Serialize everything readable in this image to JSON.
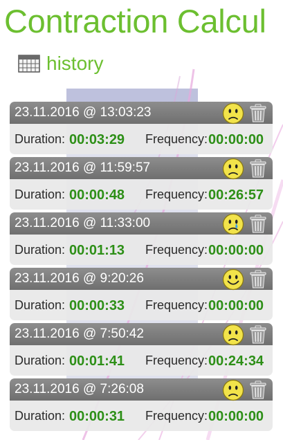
{
  "app": {
    "title": "Contraction Calcul"
  },
  "section": {
    "title": "history",
    "icon": "calendar-icon"
  },
  "labels": {
    "duration": "Duration:",
    "frequency": "Frequency:"
  },
  "icons": {
    "mood": "smiley-face-icon",
    "delete": "trash-icon"
  },
  "colors": {
    "accent": "#6cbf30",
    "value": "#2d8f17",
    "header": "#7a7a7a",
    "smiley": "#f2e34a"
  },
  "entries": [
    {
      "timestamp": "23.11.2016 @ 13:03:23",
      "duration": "00:03:29",
      "frequency": "00:00:00",
      "mood": "sad"
    },
    {
      "timestamp": "23.11.2016 @ 11:59:57",
      "duration": "00:00:48",
      "frequency": "00:26:57",
      "mood": "sad"
    },
    {
      "timestamp": "23.11.2016 @ 11:33:00",
      "duration": "00:01:13",
      "frequency": "00:00:00",
      "mood": "crying"
    },
    {
      "timestamp": "23.11.2016 @ 9:20:26",
      "duration": "00:00:33",
      "frequency": "00:00:00",
      "mood": "happy"
    },
    {
      "timestamp": "23.11.2016 @ 7:50:42",
      "duration": "00:01:41",
      "frequency": "00:24:34",
      "mood": "sad"
    },
    {
      "timestamp": "23.11.2016 @ 7:26:08",
      "duration": "00:00:31",
      "frequency": "00:00:00",
      "mood": "sad"
    }
  ]
}
